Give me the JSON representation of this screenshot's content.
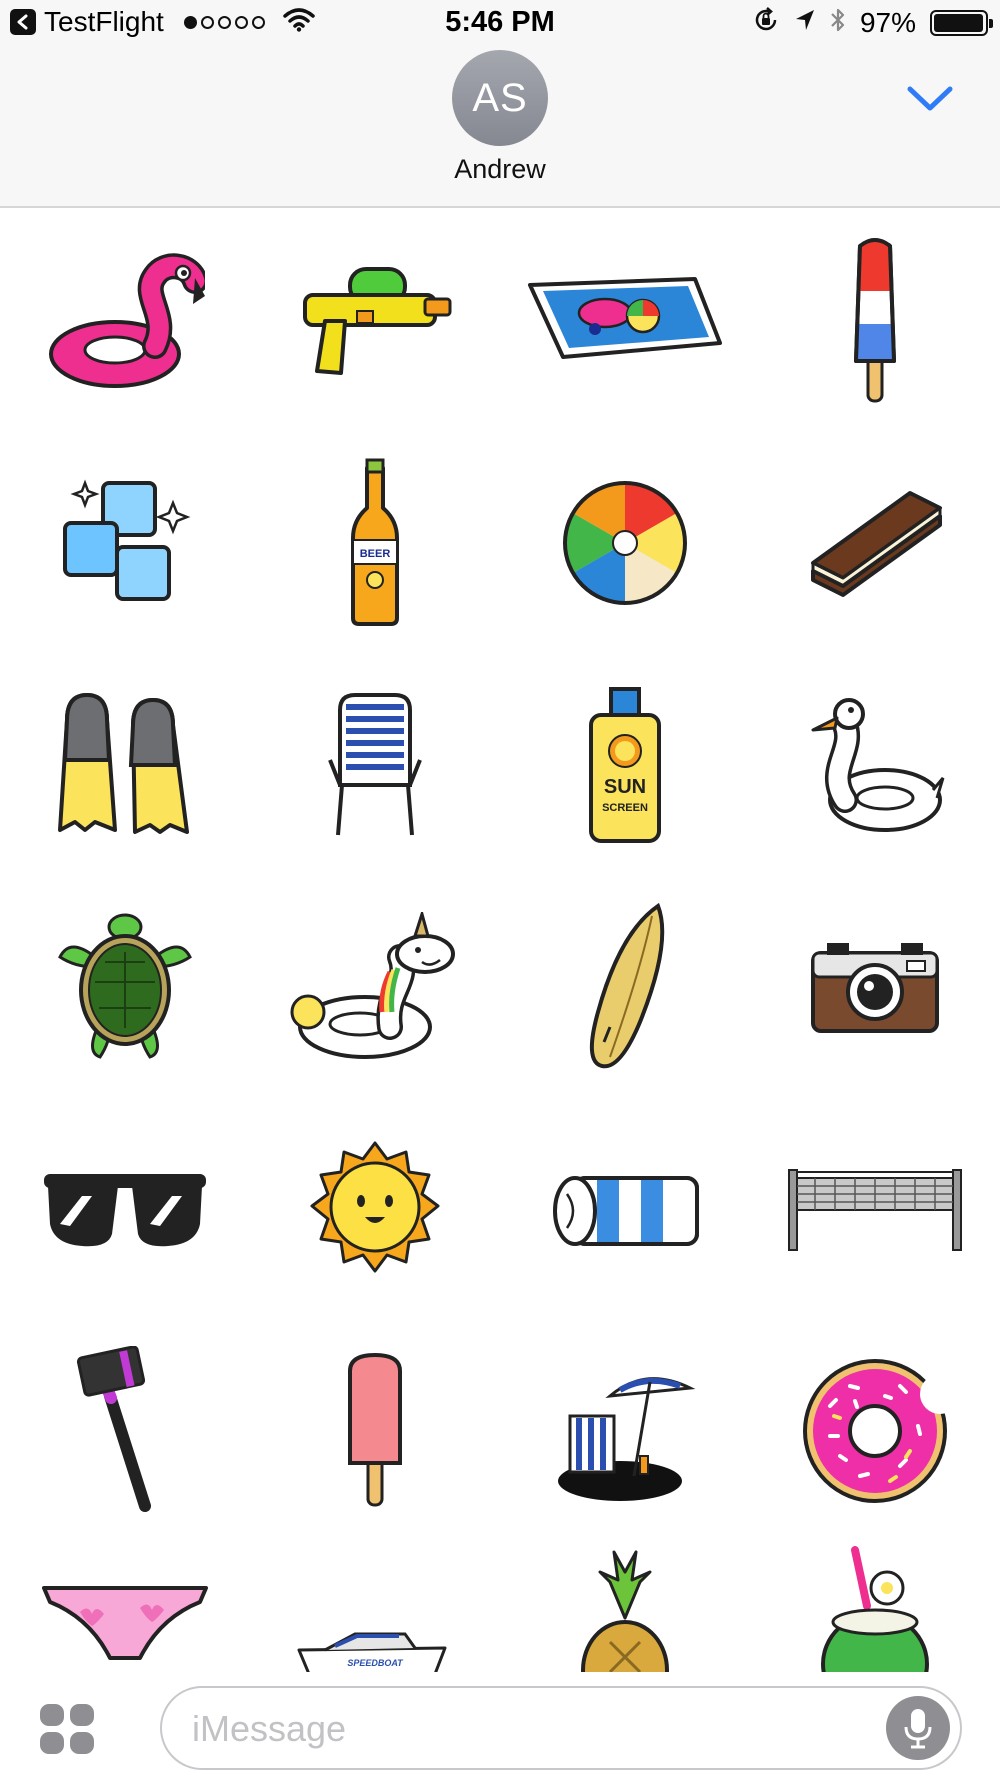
{
  "status_bar": {
    "back_app": "TestFlight",
    "time": "5:46 PM",
    "battery_percent": "97%",
    "battery_level": 0.97,
    "signal_bars": 1,
    "signal_total": 5
  },
  "contact": {
    "initials": "AS",
    "name": "Andrew"
  },
  "stickers": [
    {
      "icon": "flamingo-float-icon"
    },
    {
      "icon": "water-gun-icon"
    },
    {
      "icon": "pool-icon"
    },
    {
      "icon": "rocket-popsicle-icon"
    },
    {
      "icon": "ice-cubes-icon"
    },
    {
      "icon": "beer-bottle-icon",
      "label": "BEER"
    },
    {
      "icon": "beach-ball-icon"
    },
    {
      "icon": "ice-cream-sandwich-icon"
    },
    {
      "icon": "flippers-icon"
    },
    {
      "icon": "lawn-chair-icon"
    },
    {
      "icon": "sunscreen-icon",
      "label_line1": "SUN",
      "label_line2": "SCREEN"
    },
    {
      "icon": "swan-float-icon"
    },
    {
      "icon": "sea-turtle-icon"
    },
    {
      "icon": "unicorn-float-icon"
    },
    {
      "icon": "surfboard-icon"
    },
    {
      "icon": "camera-icon"
    },
    {
      "icon": "sunglasses-icon"
    },
    {
      "icon": "sun-icon"
    },
    {
      "icon": "beach-towel-icon"
    },
    {
      "icon": "volleyball-net-icon"
    },
    {
      "icon": "selfie-stick-icon"
    },
    {
      "icon": "pink-popsicle-icon"
    },
    {
      "icon": "beach-chair-umbrella-icon"
    },
    {
      "icon": "donut-icon"
    },
    {
      "icon": "bikini-bottom-icon"
    },
    {
      "icon": "speedboat-icon",
      "label": "SPEEDBOAT"
    },
    {
      "icon": "pineapple-icon"
    },
    {
      "icon": "coconut-drink-icon"
    }
  ],
  "input": {
    "placeholder": "iMessage"
  },
  "colors": {
    "accent": "#2f7cf6",
    "avatar_gray": "#8e9098",
    "header_bg": "#f7f7f7"
  }
}
